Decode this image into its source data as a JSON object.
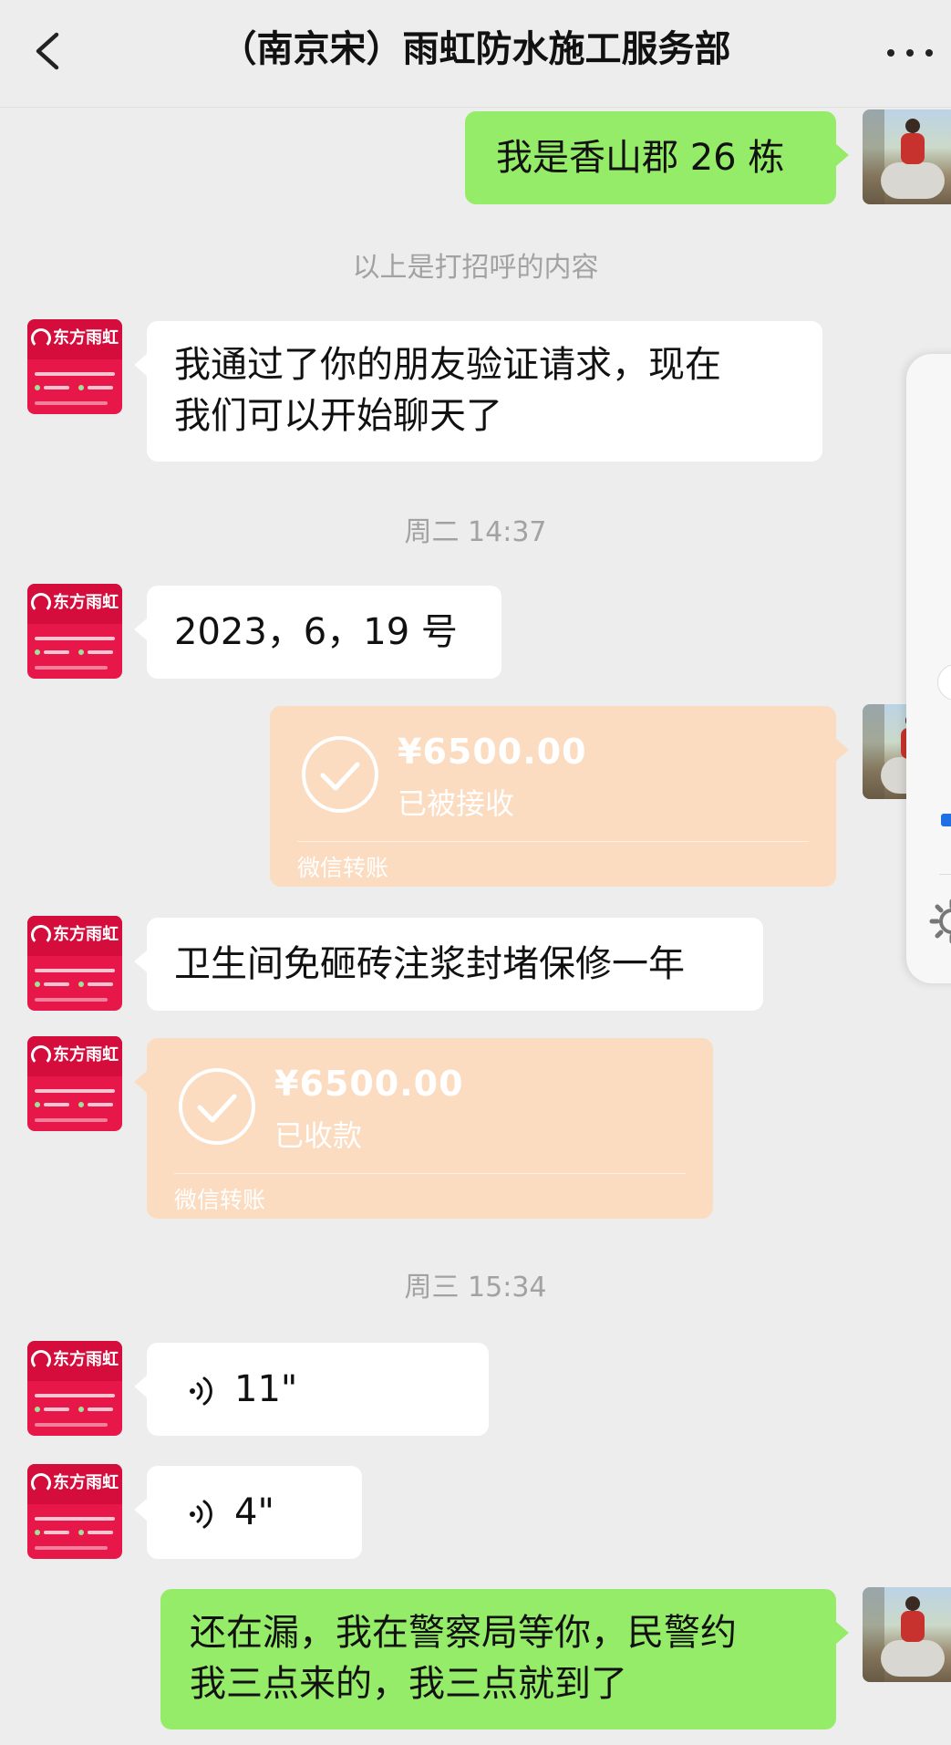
{
  "header": {
    "title": "（南京宋）雨虹防水施工服务部",
    "back_icon": "chevron-left-icon",
    "more_icon": "more-dots-icon"
  },
  "contact_avatar": {
    "brand_text": "东方雨虹"
  },
  "messages": [
    {
      "type": "text",
      "side": "right",
      "text": "我是香山郡 26 栋"
    },
    {
      "type": "system",
      "text": "以上是打招呼的内容"
    },
    {
      "type": "text",
      "side": "left",
      "lines": [
        "我通过了你的朋友验证请求，现在",
        "我们可以开始聊天了"
      ]
    },
    {
      "type": "timestamp",
      "text": "周二 14:37"
    },
    {
      "type": "text",
      "side": "left",
      "text": "2023，6，19 号"
    },
    {
      "type": "transfer",
      "side": "right",
      "amount": "¥6500.00",
      "status": "已被接收",
      "source": "微信转账"
    },
    {
      "type": "text",
      "side": "left",
      "text": "卫生间免砸砖注浆封堵保修一年"
    },
    {
      "type": "transfer",
      "side": "left",
      "amount": "¥6500.00",
      "status": "已收款",
      "source": "微信转账"
    },
    {
      "type": "timestamp",
      "text": "周三 15:34"
    },
    {
      "type": "voice",
      "side": "left",
      "duration": "11\""
    },
    {
      "type": "voice",
      "side": "left",
      "duration": "4\""
    },
    {
      "type": "text",
      "side": "right",
      "lines": [
        "还在漏，我在警察局等你，民警约",
        "我三点来的，我三点就到了"
      ]
    }
  ],
  "colors": {
    "background": "#ededed",
    "green_bubble": "#95ec69",
    "white_bubble": "#ffffff",
    "transfer": "#fbdcc0",
    "brand_red": "#e8174a"
  }
}
